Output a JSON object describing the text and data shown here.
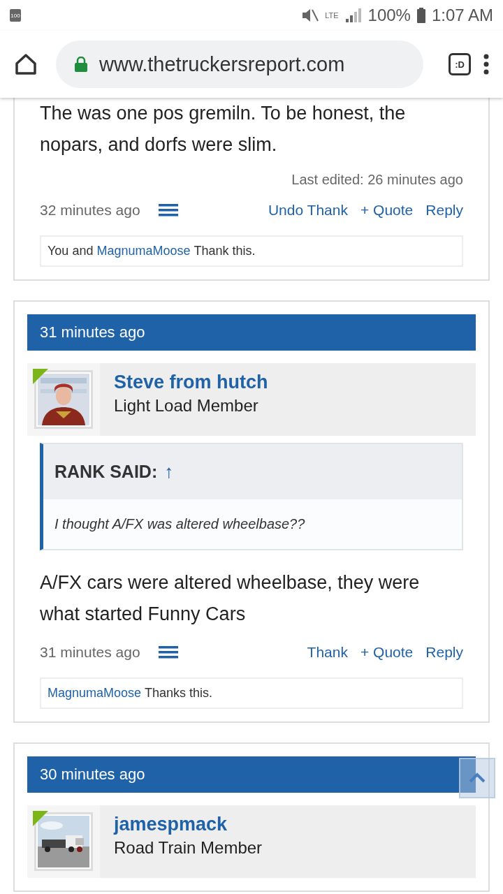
{
  "status_bar": {
    "battery_badge": "100",
    "network": "LTE",
    "battery": "100%",
    "time": "1:07 AM"
  },
  "browser": {
    "url": "www.thetruckersreport.com",
    "tab_badge": ":D"
  },
  "posts": [
    {
      "body": "The was one pos gremiln. To be honest, the nopars, and dorfs were slim.",
      "last_edited": "Last edited: 26 minutes ago",
      "time": "32 minutes ago",
      "actions": [
        "Undo Thank",
        "+ Quote",
        "Reply"
      ],
      "likes": [
        {
          "kind": "text",
          "text": "You and"
        },
        {
          "kind": "link",
          "text": "MagnumaMoose"
        },
        {
          "kind": "text",
          "text": "Thank this."
        }
      ]
    },
    {
      "header": "31 minutes ago",
      "author": {
        "name": "Steve from hutch",
        "title": "Light Load Member"
      },
      "quote": {
        "heading": "RANK SAID:",
        "arrow": "↑",
        "text": "I thought A/FX was altered wheelbase??"
      },
      "body": "A/FX cars were altered wheelbase, they were what started Funny Cars",
      "time": "31 minutes ago",
      "actions": [
        "Thank",
        "+ Quote",
        "Reply"
      ],
      "likes": [
        {
          "kind": "link",
          "text": "MagnumaMoose"
        },
        {
          "kind": "text",
          "text": "Thanks this."
        }
      ]
    },
    {
      "header": "30 minutes ago",
      "author": {
        "name": "jamespmack",
        "title": "Road Train Member"
      }
    }
  ]
}
